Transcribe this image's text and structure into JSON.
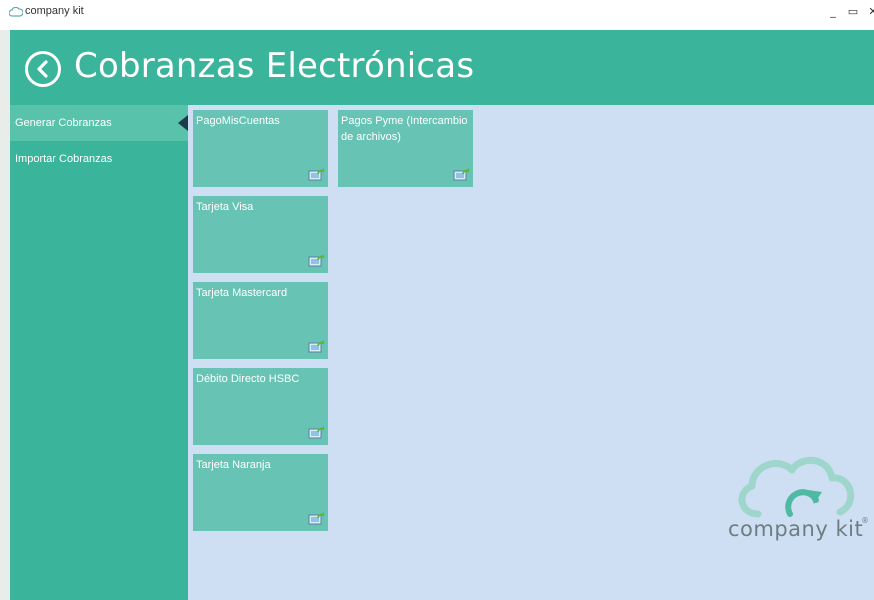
{
  "window": {
    "title": "company kit",
    "min_glyph": "_",
    "max_glyph": "▭",
    "close_glyph": "✕"
  },
  "header": {
    "title": "Cobranzas Electrónicas",
    "back_icon": "chevron-left-icon"
  },
  "sidebar": {
    "items": [
      {
        "label": "Generar Cobranzas",
        "active": true
      },
      {
        "label": "Importar Cobranzas",
        "active": false
      }
    ]
  },
  "tiles": [
    {
      "label": "PagoMisCuentas",
      "icon": "pc-refresh-icon"
    },
    {
      "label": "Pagos Pyme (Intercambio de archivos)",
      "icon": "pc-refresh-icon"
    },
    {
      "label": "Tarjeta Visa",
      "icon": "pc-refresh-icon"
    },
    {
      "label": "Tarjeta Mastercard",
      "icon": "pc-refresh-icon"
    },
    {
      "label": "Débito Directo HSBC",
      "icon": "pc-refresh-icon"
    },
    {
      "label": "Tarjeta Naranja",
      "icon": "pc-refresh-icon"
    }
  ],
  "logo": {
    "text": "company kit",
    "reg": "®"
  },
  "colors": {
    "accent": "#3ab49b",
    "tile": "#67c3b4",
    "content_bg": "#cfdff3",
    "logo_gray": "#6f7d82"
  }
}
